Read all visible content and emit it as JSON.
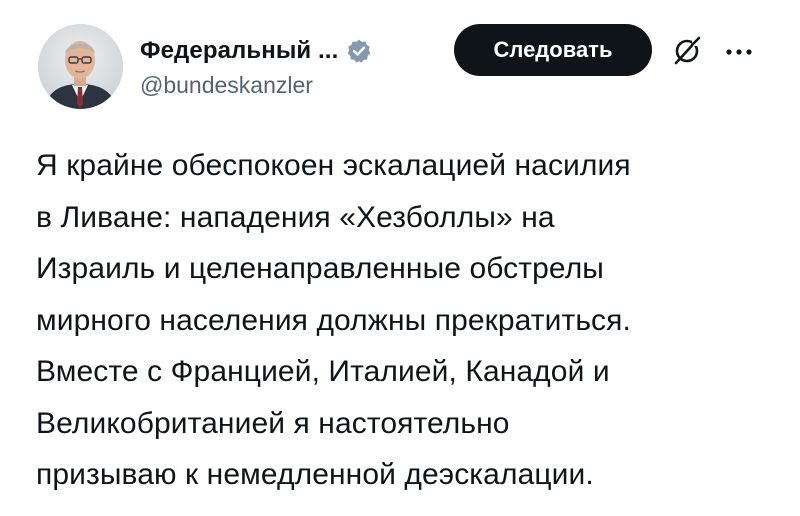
{
  "author": {
    "display_name": "Федеральный ...",
    "handle": "@bundeskanzler",
    "verified": true,
    "verified_badge_color": "#829aab",
    "avatar_icon": "portrait-photo"
  },
  "actions": {
    "follow_label": "Следовать",
    "grok_icon": "grok-slash-icon",
    "more_icon": "more-dots-icon"
  },
  "tweet": {
    "lines": [
      "Я крайне обеспокоен эскалацией насилия",
      "в Ливане: нападения «Хезболлы» на",
      "Израиль и целенаправленные обстрелы",
      "мирного населения должны прекратиться.",
      "Вместе с Францией, Италией, Канадой и",
      "Великобританией я настоятельно",
      "призываю к немедленной деэскалации."
    ]
  },
  "colors": {
    "text": "#0f1419",
    "secondary_text": "#536471",
    "button_bg": "#0f1419",
    "button_text": "#ffffff"
  }
}
